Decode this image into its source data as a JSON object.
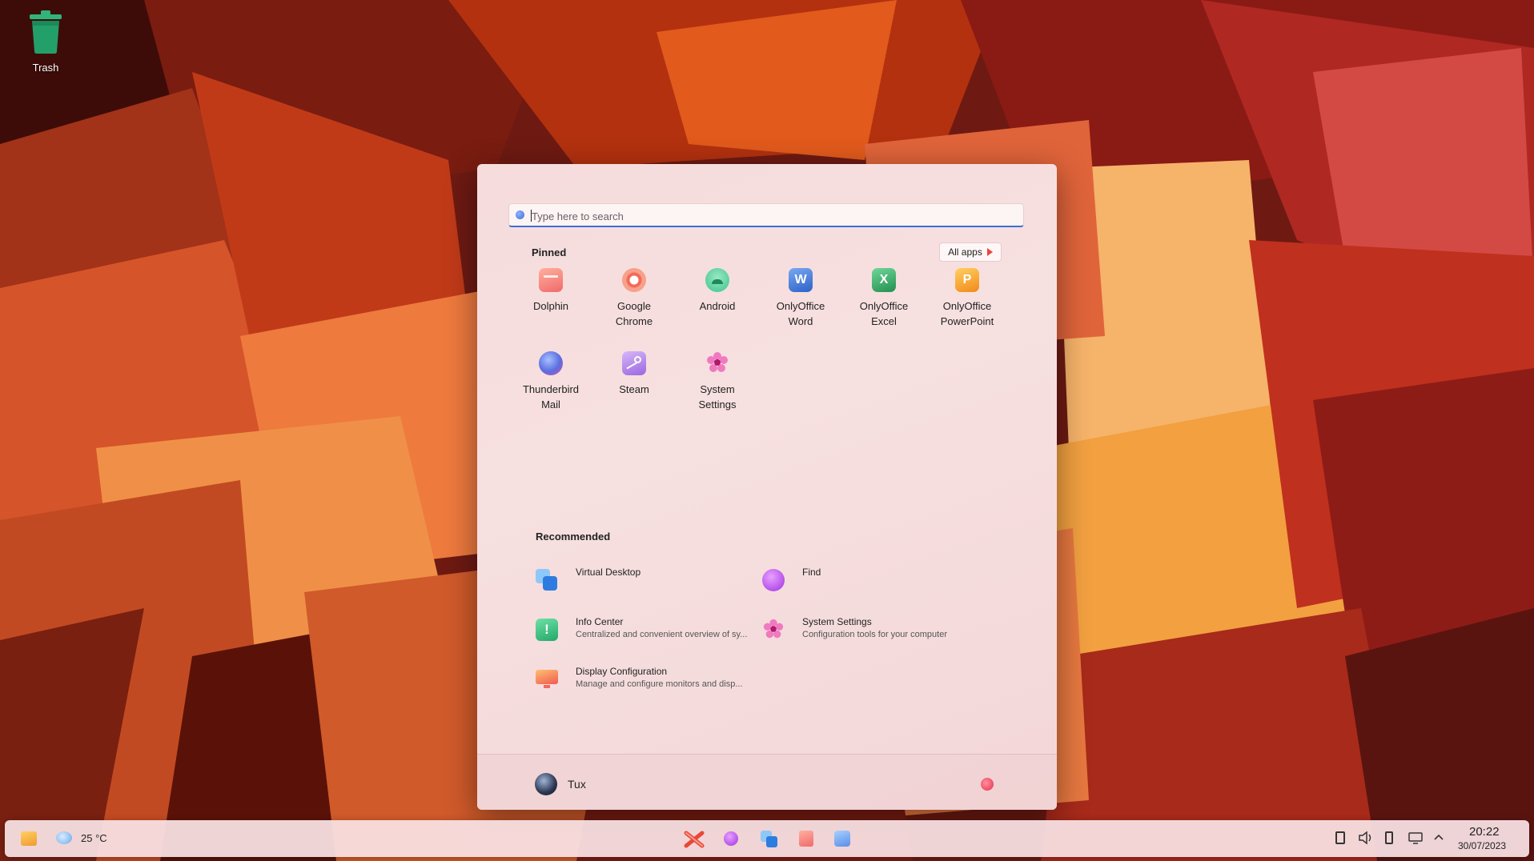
{
  "desktop": {
    "icons": [
      {
        "label": "Trash",
        "icon": "trash-icon"
      }
    ]
  },
  "start_menu": {
    "search": {
      "placeholder": "Type here to search"
    },
    "pinned": {
      "title": "Pinned",
      "all_apps_label": "All apps",
      "apps": [
        {
          "name": "Dolphin",
          "icon": "dolphin-icon",
          "color": "#f08a8a"
        },
        {
          "name": "Google Chrome",
          "icon": "chrome-icon",
          "color": "#f06a5a"
        },
        {
          "name": "Android",
          "icon": "android-icon",
          "color": "#3cc48a"
        },
        {
          "name": "OnlyOffice Word",
          "icon": "word-icon",
          "color": "#3b7be0"
        },
        {
          "name": "OnlyOffice Excel",
          "icon": "excel-icon",
          "color": "#2fa860"
        },
        {
          "name": "OnlyOffice PowerPoint",
          "icon": "powerpoint-icon",
          "color": "#f0a020"
        },
        {
          "name": "Thunderbird Mail",
          "icon": "thunderbird-icon",
          "color": "#5a6ee0"
        },
        {
          "name": "Steam",
          "icon": "steam-icon",
          "color": "#a46ee0"
        },
        {
          "name": "System Settings",
          "icon": "settings-flower-icon",
          "color": "#e04aa8"
        }
      ]
    },
    "recommended": {
      "title": "Recommended",
      "items": [
        {
          "title": "Virtual Desktop",
          "subtitle": "",
          "icon": "virtual-desktop-icon"
        },
        {
          "title": "Find",
          "subtitle": "",
          "icon": "find-icon"
        },
        {
          "title": "Info Center",
          "subtitle": "Centralized and convenient overview of sy...",
          "icon": "info-center-icon"
        },
        {
          "title": "System Settings",
          "subtitle": "Configuration tools for your computer",
          "icon": "settings-flower-icon"
        },
        {
          "title": "Display Configuration",
          "subtitle": "Manage and configure monitors and disp...",
          "icon": "display-icon"
        }
      ]
    },
    "user": {
      "name": "Tux"
    }
  },
  "taskbar": {
    "weather": {
      "temperature": "25 °C"
    },
    "clock": {
      "time": "20:22",
      "date": "30/07/2023"
    }
  }
}
